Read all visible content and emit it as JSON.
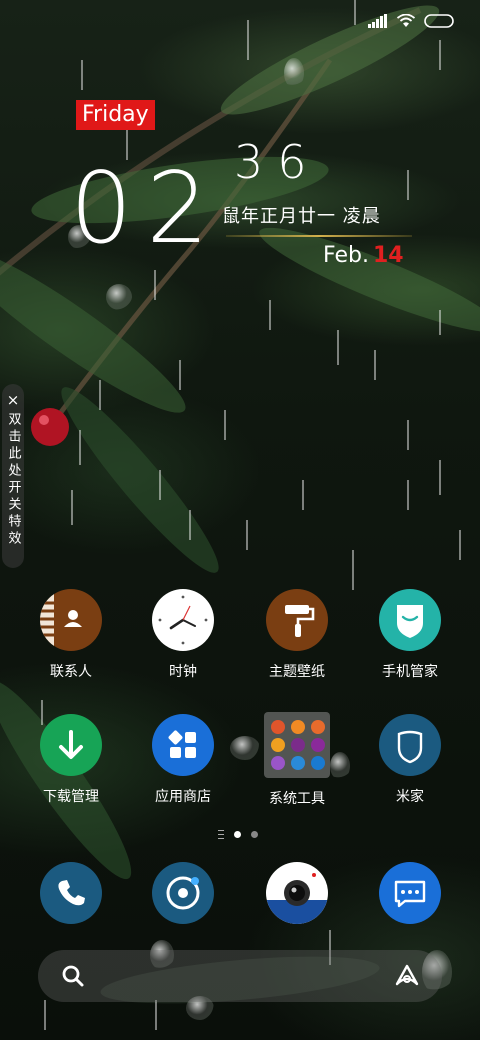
{
  "status_bar": {
    "icons": [
      "signal-icon",
      "wifi-icon",
      "battery-icon"
    ]
  },
  "clock_widget": {
    "day": "Friday",
    "hour": "02",
    "minute": "36",
    "lunar_date": "鼠年正月廿一 凌晨",
    "month": "Feb.",
    "day_number": "14",
    "colors": {
      "day_badge": "#e01818",
      "day_number": "#e02020",
      "divider": "#d2b04c"
    }
  },
  "side_toggle": {
    "close_symbol": "×",
    "label": "双击此处开关特效"
  },
  "apps": [
    {
      "label": "联系人",
      "icon": "contacts-icon",
      "color": "#7a3e12"
    },
    {
      "label": "时钟",
      "icon": "clock-icon",
      "color": "#ffffff"
    },
    {
      "label": "主题壁纸",
      "icon": "theme-brush-icon",
      "color": "#7a3e12"
    },
    {
      "label": "手机管家",
      "icon": "security-shield-icon",
      "color": "#24b3a8"
    },
    {
      "label": "下载管理",
      "icon": "download-icon",
      "color": "#17a456"
    },
    {
      "label": "应用商店",
      "icon": "app-store-icon",
      "color": "#1a6fd8"
    },
    {
      "label": "系统工具",
      "icon": "folder-icon",
      "color": "#8c8c8c"
    },
    {
      "label": "米家",
      "icon": "mijia-icon",
      "color": "#1b5a80"
    }
  ],
  "dock": [
    {
      "icon": "phone-icon",
      "color": "#1b5a80"
    },
    {
      "icon": "browser-icon",
      "color": "#1b5a80"
    },
    {
      "icon": "camera-icon",
      "color": "#ffffff"
    },
    {
      "icon": "messages-icon",
      "color": "#1a6fd8"
    }
  ],
  "page_indicator": {
    "pages": 2,
    "current": 1
  },
  "search_bar": {
    "left_icon": "search-icon",
    "right_icon": "assistant-icon"
  }
}
